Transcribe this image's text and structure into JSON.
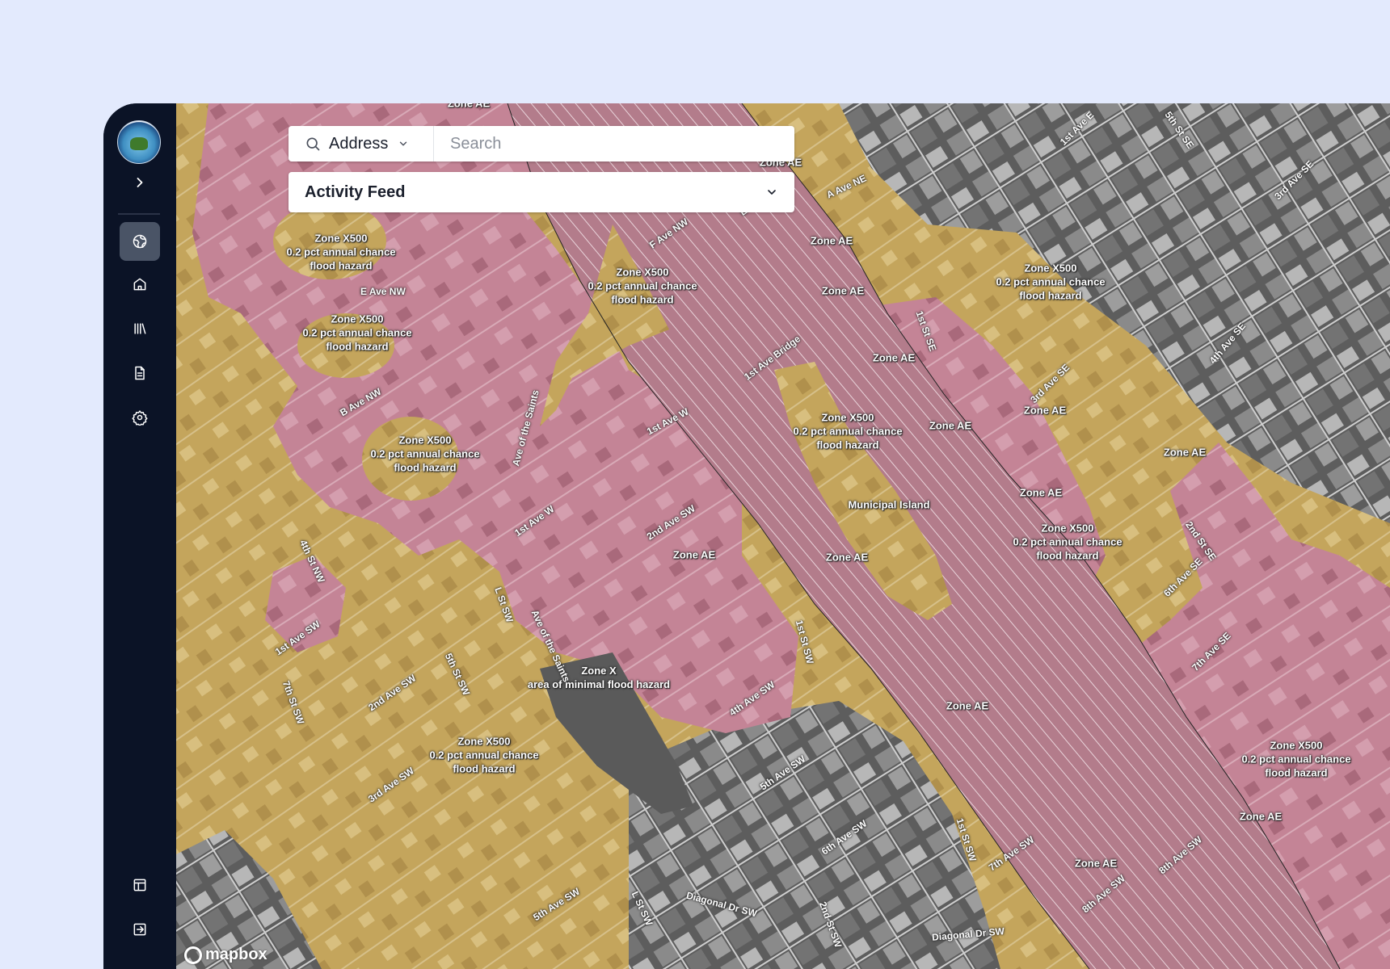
{
  "search": {
    "type_label": "Address",
    "placeholder": "Search"
  },
  "feed": {
    "label": "Activity Feed"
  },
  "map": {
    "attribution": "mapbox",
    "zone_labels": [
      {
        "id": "z1",
        "lines": [
          "Zone X500",
          "0.2 pct annual chance",
          "flood hazard"
        ]
      },
      {
        "id": "z2",
        "lines": [
          "Zone X500",
          "0.2 pct annual chance",
          "flood hazard"
        ]
      },
      {
        "id": "z3",
        "lines": [
          "Zone X500",
          "0.2 pct annual chance",
          "flood hazard"
        ]
      },
      {
        "id": "z4",
        "lines": [
          "Zone X500",
          "0.2 pct annual chance",
          "flood hazard"
        ]
      },
      {
        "id": "z5",
        "lines": [
          "Zone X500",
          "0.2 pct annual chance",
          "flood hazard"
        ]
      },
      {
        "id": "z6",
        "lines": [
          "Zone X500",
          "0.2 pct annual chance",
          "flood hazard"
        ]
      },
      {
        "id": "z7",
        "lines": [
          "Zone X500",
          "0.2 pct annual chance",
          "flood hazard"
        ]
      },
      {
        "id": "z8",
        "lines": [
          "Zone X500",
          "0.2 pct annual chance",
          "flood hazard"
        ]
      },
      {
        "id": "z9",
        "lines": [
          "Zone X500",
          "0.2 pct annual chance",
          "flood hazard"
        ]
      },
      {
        "id": "z10",
        "lines": [
          "Zone X",
          "area of minimal flood hazard"
        ]
      },
      {
        "id": "ae1",
        "lines": [
          "Zone AE"
        ]
      },
      {
        "id": "ae2",
        "lines": [
          "Zone AE"
        ]
      },
      {
        "id": "ae3",
        "lines": [
          "Zone AE"
        ]
      },
      {
        "id": "ae4",
        "lines": [
          "Zone AE"
        ]
      },
      {
        "id": "ae5",
        "lines": [
          "Zone AE"
        ]
      },
      {
        "id": "ae6",
        "lines": [
          "Zone AE"
        ]
      },
      {
        "id": "ae7",
        "lines": [
          "Zone AE"
        ]
      },
      {
        "id": "ae8",
        "lines": [
          "Zone AE"
        ]
      },
      {
        "id": "ae9",
        "lines": [
          "Zone AE"
        ]
      },
      {
        "id": "ae10",
        "lines": [
          "Zone AE"
        ]
      },
      {
        "id": "ae11",
        "lines": [
          "Zone AE"
        ]
      },
      {
        "id": "ae12",
        "lines": [
          "Zone AE"
        ]
      },
      {
        "id": "ae13",
        "lines": [
          "Zone AE"
        ]
      },
      {
        "id": "ae14",
        "lines": [
          "Zone AE"
        ]
      },
      {
        "id": "island",
        "lines": [
          "Municipal Island"
        ]
      }
    ],
    "streets": [
      "E Ave NW",
      "B Ave NW",
      "F Ave NW",
      "E Ave NE",
      "A Ave NE",
      "1st Ave E",
      "5th St SE",
      "3rd Ave SE",
      "1st St SE",
      "1st Ave Bridge",
      "3rd Ave SE",
      "4th Ave SE",
      "Ave of the Saints",
      "1st Ave W",
      "1st Ave W",
      "2nd Ave SW",
      "L St SW",
      "Ave of the Saints",
      "4th St NW",
      "1st Ave SW",
      "2nd Ave SW",
      "5th St SW",
      "7th St SW",
      "3rd Ave SW",
      "4th Ave SW",
      "1st St SW",
      "5th Ave SW",
      "6th Ave SW",
      "7th Ave SW",
      "8th Ave SW",
      "8th Ave SW",
      "Diagonal Dr SW",
      "Diagonal Dr SW",
      "2nd St SW",
      "1st St SW",
      "5th Ave SW",
      "L St SW",
      "2nd St SE",
      "6th Ave SE",
      "7th Ave SE",
      "Zone AE"
    ]
  },
  "nav": [
    {
      "name": "map-nav",
      "icon": "map-icon"
    },
    {
      "name": "home-nav",
      "icon": "home-icon"
    },
    {
      "name": "library-nav",
      "icon": "library-icon"
    },
    {
      "name": "documents-nav",
      "icon": "document-icon"
    },
    {
      "name": "settings-nav",
      "icon": "gear-icon"
    },
    {
      "name": "layout-nav",
      "icon": "layout-icon"
    },
    {
      "name": "logout-nav",
      "icon": "logout-icon"
    }
  ],
  "colors": {
    "sidebar": "#0b1326",
    "flood_ae": "#c78599",
    "flood_x500": "#c8a85a",
    "background": "#e3eafd"
  }
}
